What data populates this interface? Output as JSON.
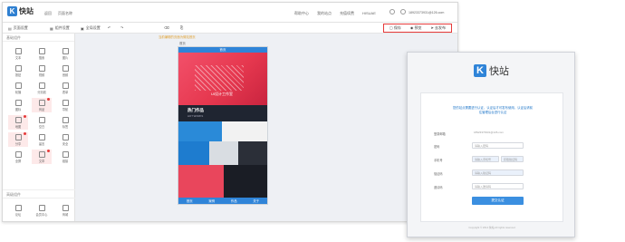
{
  "editor": {
    "brand": "快站",
    "breadcrumbs": [
      "返回",
      "页面名称"
    ],
    "topnav": [
      "帮助中心",
      "我的站点",
      "充值续费",
      "HISUAE"
    ],
    "account": "18923373931@126.com",
    "toolbar": {
      "items": [
        "页面设置",
        "组件设置",
        "全局设置"
      ],
      "actions": [
        "保存",
        "预览",
        "去发布"
      ]
    },
    "sidebar": {
      "section1": "基础组件",
      "components": [
        {
          "label": "文本",
          "icon": "text-icon"
        },
        {
          "label": "搜索",
          "icon": "search-icon"
        },
        {
          "label": "图片",
          "icon": "image-icon"
        },
        {
          "label": "按钮",
          "icon": "button-icon"
        },
        {
          "label": "视频",
          "icon": "video-icon"
        },
        {
          "label": "音频",
          "icon": "audio-icon"
        },
        {
          "label": "轮播",
          "icon": "carousel-icon"
        },
        {
          "label": "分割线",
          "icon": "divider-icon"
        },
        {
          "label": "表单",
          "icon": "form-icon"
        },
        {
          "label": "图标",
          "icon": "icon-icon"
        },
        {
          "label": "商品",
          "icon": "product-icon",
          "highlight": true,
          "badge": true
        },
        {
          "label": "导航",
          "icon": "nav-icon"
        },
        {
          "label": "地图",
          "icon": "map-icon",
          "highlight": true,
          "badge": true
        },
        {
          "label": "空白",
          "icon": "blank-icon"
        },
        {
          "label": "标签",
          "icon": "tag-icon"
        },
        {
          "label": "分享",
          "icon": "share-icon",
          "highlight": true,
          "badge": true
        },
        {
          "label": "留言",
          "icon": "comment-icon"
        },
        {
          "label": "安全",
          "icon": "shield-icon"
        },
        {
          "label": "全屏",
          "icon": "fullscreen-icon"
        },
        {
          "label": "文章",
          "icon": "article-icon",
          "highlight": true,
          "badge": true
        },
        {
          "label": "链接",
          "icon": "link-icon"
        }
      ],
      "section2": "高级组件",
      "advanced": [
        {
          "label": "论坛",
          "icon": "forum-icon"
        },
        {
          "label": "会员中心",
          "icon": "member-icon"
        },
        {
          "label": "商城",
          "icon": "shop-icon"
        }
      ]
    },
    "canvas": {
      "note": "当前编辑的页面为微站首页",
      "phone_label": "首页",
      "phone_header": "首页",
      "banner_title": "UI设计工作室",
      "section_title": "热门作品",
      "section_sub": "HOT WORKS",
      "footer_tabs": [
        "首页",
        "案例",
        "作品",
        "关于"
      ]
    }
  },
  "login": {
    "brand": "快站",
    "message": "您的站点需要进行认证，认证后才可发布使用，认证后请前往管理后台进行认证",
    "fields": [
      {
        "label": "登录邮箱",
        "value": "18923373931@126.com",
        "style": "plain"
      },
      {
        "label": "密码",
        "value": "请输入密码",
        "style": "plain"
      },
      {
        "label": "手机号",
        "value": "请输入手机号",
        "extra": "获取验证码",
        "style": "blue"
      },
      {
        "label": "验证码",
        "value": "请输入验证码",
        "style": "blue"
      },
      {
        "label": "邀请码",
        "value": "请输入邀请码",
        "style": "plain"
      }
    ],
    "submit": "提交认证",
    "copyright": "Copyright © 2014 快站 All rights reserved"
  }
}
